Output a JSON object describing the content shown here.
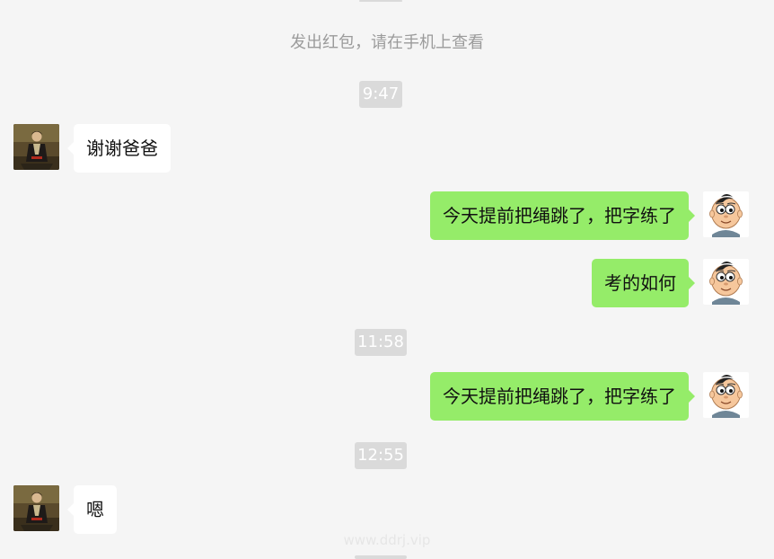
{
  "system_note": "发出红包，请在手机上查看",
  "watermark": "www.ddrj.vip",
  "messages": [
    {
      "type": "time",
      "text": "9:47"
    },
    {
      "type": "incoming",
      "sender_avatar": "dad-portrait-avatar",
      "text": "谢谢爸爸"
    },
    {
      "type": "outgoing",
      "sender_avatar": "cartoon-boy-avatar",
      "text": "今天提前把绳跳了，把字练了"
    },
    {
      "type": "outgoing",
      "sender_avatar": "cartoon-boy-avatar",
      "text": "考的如何"
    },
    {
      "type": "time",
      "text": "11:58"
    },
    {
      "type": "outgoing",
      "sender_avatar": "cartoon-boy-avatar",
      "text": "今天提前把绳跳了，把字练了"
    },
    {
      "type": "time",
      "text": "12:55"
    },
    {
      "type": "incoming",
      "sender_avatar": "dad-portrait-avatar",
      "text": "嗯"
    }
  ]
}
